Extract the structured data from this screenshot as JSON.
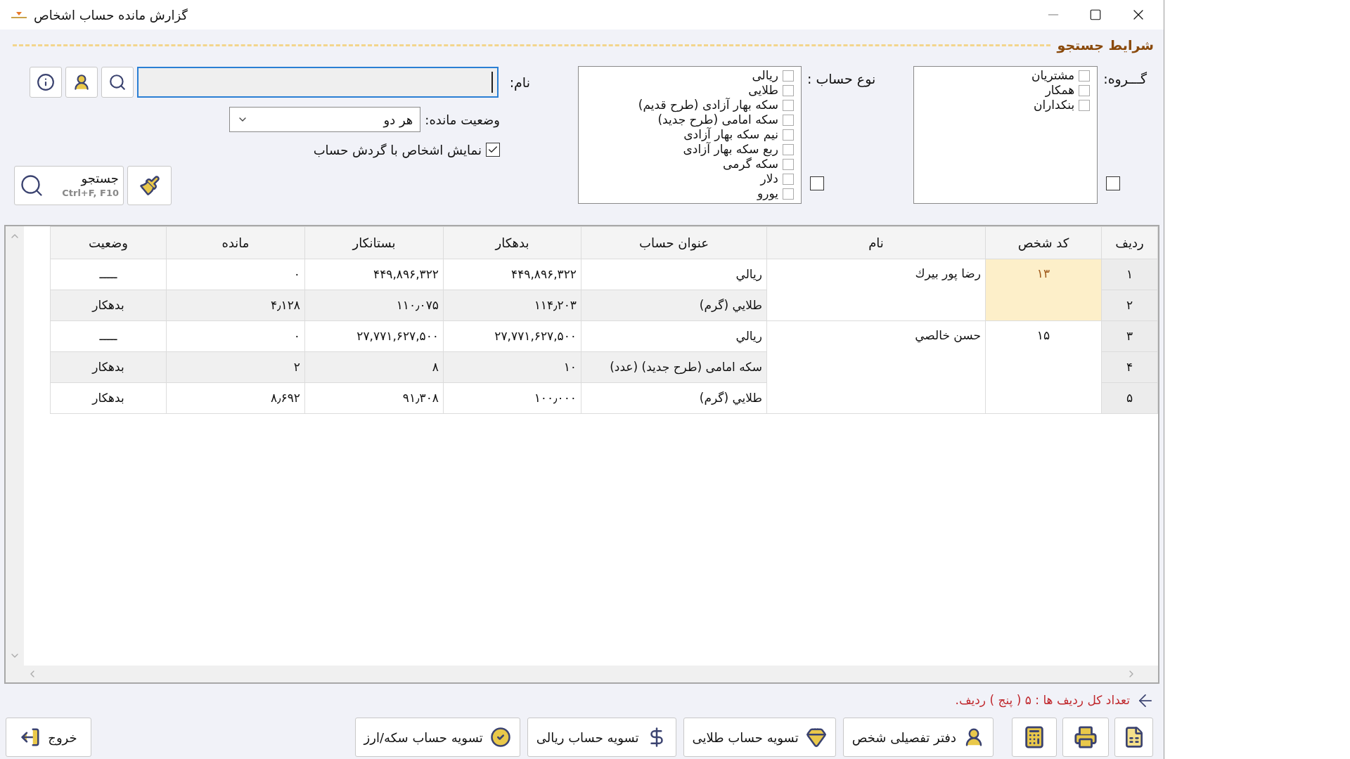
{
  "window": {
    "title": "گزارش مانده حساب اشخاص"
  },
  "search_section": {
    "title": "شرايط جستجو"
  },
  "group_filter": {
    "label": "گـــروه:",
    "select_all_checked": false,
    "options": [
      {
        "label": "مشتریان",
        "checked": false
      },
      {
        "label": "همکار",
        "checked": false
      },
      {
        "label": "بنکداران",
        "checked": false
      }
    ]
  },
  "account_type_filter": {
    "label": "نوع حساب :",
    "select_all_checked": false,
    "options": [
      {
        "label": "ریالی",
        "checked": false
      },
      {
        "label": "طلایی",
        "checked": false
      },
      {
        "label": "سکه بهار آزادی (طرح قدیم)",
        "checked": false
      },
      {
        "label": "سکه امامی (طرح جدید)",
        "checked": false
      },
      {
        "label": "نیم سکه بهار آزادی",
        "checked": false
      },
      {
        "label": "ربع سکه بهار آزادی",
        "checked": false
      },
      {
        "label": "سکه گرمی",
        "checked": false
      },
      {
        "label": "دلار",
        "checked": false
      },
      {
        "label": "یورو",
        "checked": false
      }
    ]
  },
  "name_field": {
    "label": "نام:"
  },
  "balance_status": {
    "label": "وضعیت مانده:",
    "value": "هر دو"
  },
  "show_active_checkbox": {
    "label": "نمایش اشخاص با گردش حساب",
    "checked": true
  },
  "search_button": {
    "label": "جستجو",
    "shortcut": "Ctrl+F, F10"
  },
  "table": {
    "columns": [
      "ردیف",
      "کد شخص",
      "نام",
      "عنوان حساب",
      "بدهکار",
      "بستانکار",
      "مانده",
      "وضعیت"
    ],
    "persons": [
      {
        "code": "۱۳",
        "name": "رضا پور بيرك",
        "selected": true,
        "rows": [
          {
            "row": "۱",
            "account": "ريالي",
            "debit": "۴۴۹,۸۹۶,۳۲۲",
            "credit": "۴۴۹,۸۹۶,۳۲۲",
            "balance": "۰",
            "status": "ـــــ"
          },
          {
            "row": "۲",
            "account": "طلايي (گرم)",
            "debit": "۱۱۴٫۲۰۳",
            "credit": "۱۱۰٫۰۷۵",
            "balance": "۴٫۱۲۸",
            "status": "بدهکار"
          }
        ]
      },
      {
        "code": "۱۵",
        "name": "حسن خالصي",
        "selected": false,
        "rows": [
          {
            "row": "۳",
            "account": "ريالي",
            "debit": "۲۷,۷۷۱,۶۲۷,۵۰۰",
            "credit": "۲۷,۷۷۱,۶۲۷,۵۰۰",
            "balance": "۰",
            "status": "ـــــ"
          },
          {
            "row": "۴",
            "account": "سکه امامی (طرح جدید) (عدد)",
            "debit": "۱۰",
            "credit": "۸",
            "balance": "۲",
            "status": "بدهکار"
          },
          {
            "row": "۵",
            "account": "طلايي (گرم)",
            "debit": "۱۰۰٫۰۰۰",
            "credit": "۹۱٫۳۰۸",
            "balance": "۸٫۶۹۲",
            "status": "بدهکار"
          }
        ]
      }
    ]
  },
  "status_text": "تعداد کل ردیف ها : ۵ ( پنج ) ردیف.",
  "footer_buttons": [
    {
      "label": "دفتر تفصیلی شخص"
    },
    {
      "label": "تسویه حساب طلایی"
    },
    {
      "label": "تسویه حساب ریالی"
    },
    {
      "label": "تسویه حساب سکه/ارز"
    }
  ],
  "exit_button": {
    "label": "خروج"
  }
}
